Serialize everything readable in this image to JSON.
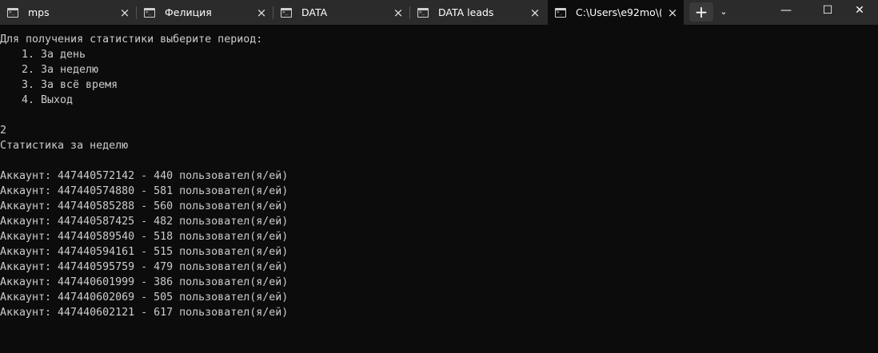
{
  "tabs": [
    {
      "title": "mps",
      "active": false
    },
    {
      "title": "Фелиция",
      "active": false
    },
    {
      "title": "DATA",
      "active": false
    },
    {
      "title": "DATA leads",
      "active": false
    },
    {
      "title": "C:\\Users\\e92mo\\(",
      "active": true
    }
  ],
  "icons": {
    "tab_icon": "terminal-icon",
    "close": "×",
    "new_tab": "+",
    "dropdown": "⌄",
    "minimize": "—",
    "maximize": "☐",
    "window_close": "✕"
  },
  "terminal": {
    "prompt": "Для получения статистики выберите период:",
    "menu": [
      "1. За день",
      "2. За неделю",
      "3. За всё время",
      "4. Выход"
    ],
    "input": "2",
    "result_title": "Статистика за неделю",
    "accounts": [
      "Аккаунт: 447440572142 - 440 пользовател(я/ей)",
      "Аккаунт: 447440574880 - 581 пользовател(я/ей)",
      "Аккаунт: 447440585288 - 560 пользовател(я/ей)",
      "Аккаунт: 447440587425 - 482 пользовател(я/ей)",
      "Аккаунт: 447440589540 - 518 пользовател(я/ей)",
      "Аккаунт: 447440594161 - 515 пользовател(я/ей)",
      "Аккаунт: 447440595759 - 479 пользовател(я/ей)",
      "Аккаунт: 447440601999 - 386 пользовател(я/ей)",
      "Аккаунт: 447440602069 - 505 пользовател(я/ей)",
      "Аккаунт: 447440602121 - 617 пользовател(я/ей)"
    ]
  },
  "colors": {
    "titlebar": "#2b2b2b",
    "terminal_bg": "#0c0c0c",
    "terminal_text": "#cccccc"
  }
}
